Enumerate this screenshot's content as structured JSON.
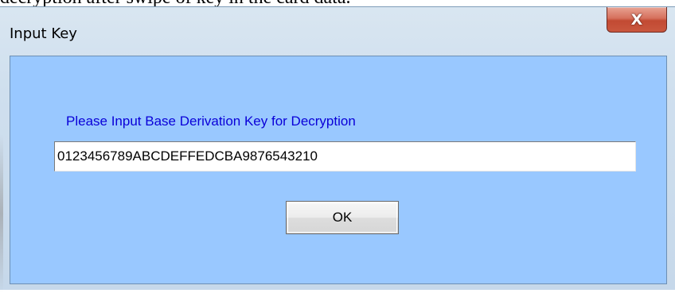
{
  "background_text": "decryption after swipe of key in the card data.",
  "window": {
    "title": "Input Key",
    "close_icon": "close-icon",
    "close_glyph": "X"
  },
  "form": {
    "prompt": "Please Input Base Derivation Key for Decryption",
    "key_value": "0123456789ABCDEFFEDCBA9876543210",
    "ok_label": "OK"
  },
  "colors": {
    "client_background": "#99c8ff",
    "prompt_text": "#0a00d8",
    "close_button": "#c24a33"
  }
}
